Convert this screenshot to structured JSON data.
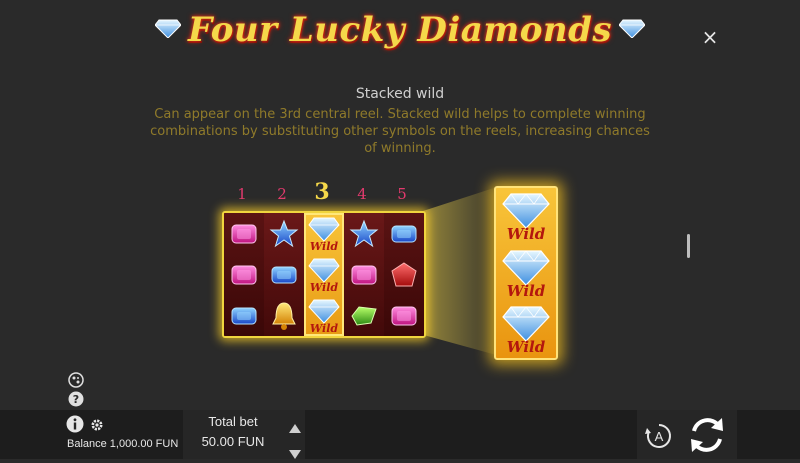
{
  "header": {
    "title": "Four Lucky Diamonds",
    "close_label": "×"
  },
  "feature": {
    "heading": "Stacked wild",
    "description": "Can appear on the 3rd central reel. Stacked wild helps to complete winning combinations by substituting other symbols on the reels, increasing chances of winning."
  },
  "reels": {
    "numbers": [
      "1",
      "2",
      "3",
      "4",
      "5"
    ],
    "active_reel": "3",
    "wild_label": "Wild",
    "grid": [
      [
        "pink-gem",
        "blue-star",
        "wild-diamond",
        "blue-star",
        "blue-gem"
      ],
      [
        "pink-gem",
        "blue-gem",
        "wild-diamond",
        "pink-gem",
        "red-gem"
      ],
      [
        "blue-gem",
        "gold-bell",
        "wild-diamond",
        "green-gem",
        "pink-gem"
      ]
    ]
  },
  "bottom_bar": {
    "balance": "Balance 1,000.00 FUN",
    "total_bet_label": "Total bet",
    "total_bet_value": "50.00 FUN",
    "auto_label": "A"
  },
  "colors": {
    "background": "#2a2a2a",
    "title": "#f5d84a",
    "reel_number": "#e33a6e",
    "description": "#8f7a2a",
    "gold": "#f0d53e"
  }
}
